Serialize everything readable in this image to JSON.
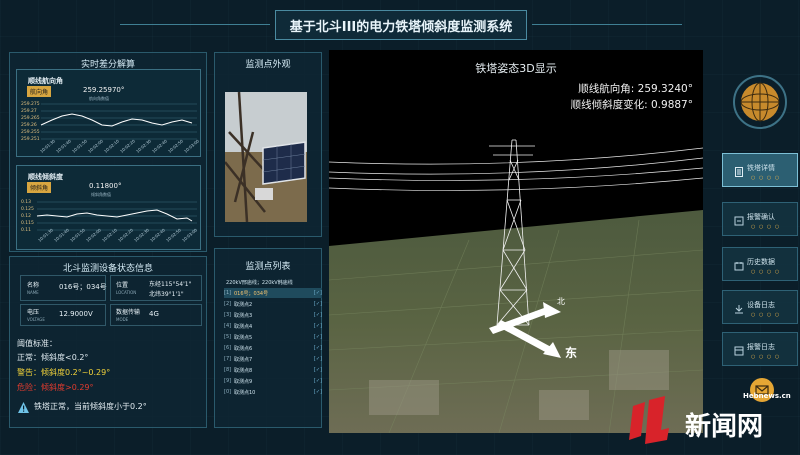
{
  "header": {
    "title": "基于北斗III的电力铁塔倾斜度监测系统"
  },
  "left_panel": {
    "title": "实时差分解算",
    "chart1": {
      "heading": "顺线航向角",
      "button": "航向角",
      "value": "259.25970°",
      "sub": "航向角数值",
      "yticks": [
        "259.275",
        "259.27",
        "259.265",
        "259.26",
        "259.255",
        "259.251"
      ],
      "xticks": [
        "10:01:30",
        "10:01:40",
        "10:01:50",
        "10:02:00",
        "10:02:10",
        "10:02:20",
        "10:02:30",
        "10:02:40",
        "10:02:50",
        "10:03:00"
      ]
    },
    "chart2": {
      "heading": "顺线倾斜度",
      "button": "倾斜角",
      "value": "0.11800°",
      "sub": "倾斜角数值",
      "yticks": [
        "0.13",
        "0.125",
        "0.12",
        "0.115",
        "0.11"
      ],
      "xticks": [
        "10:01:30",
        "10:01:40",
        "10:01:50",
        "10:02:00",
        "10:02:10",
        "10:02:20",
        "10:02:30",
        "10:02:40",
        "10:02:50",
        "10:03:00"
      ]
    }
  },
  "device_panel": {
    "title": "北斗监测设备状态信息",
    "name_label": "名称",
    "name_label_en": "NAME",
    "name_value": "016号；034号",
    "location_label": "位置",
    "location_label_en": "LOCATION",
    "location_value_1": "东经115°54'1\"",
    "location_value_2": "北纬39°1'1\"",
    "voltage_label": "电压",
    "voltage_label_en": "VOLTAGE",
    "voltage_value": "12.9000V",
    "mode_label": "数据传输",
    "mode_label_en": "MODE",
    "mode_value": "4G",
    "threshold_title": "阈值标准：",
    "normal": "正常：倾斜度<0.2°",
    "warning": "警告：倾斜度0.2°~0.29°",
    "danger": "危险：倾斜度>0.29°",
    "status": "铁塔正常，当前倾斜度小于0.2°",
    "colors": {
      "normal": "#dfeaf0",
      "warning": "#f2d23a",
      "danger": "#e23b2e",
      "status_icon": "#6fc3e8"
    }
  },
  "photo_panel": {
    "title": "监测点外观"
  },
  "list_panel": {
    "title": "监测点列表",
    "header": "220kV邢庙线；220kV韩庙线",
    "rows": [
      {
        "num": "[1]",
        "name": "016号；034号",
        "chk": "[✓]"
      },
      {
        "num": "[2]",
        "name": "取测点2",
        "chk": "[✓]"
      },
      {
        "num": "[3]",
        "name": "取测点3",
        "chk": "[✓]"
      },
      {
        "num": "[4]",
        "name": "取测点4",
        "chk": "[✓]"
      },
      {
        "num": "[5]",
        "name": "取测点5",
        "chk": "[✓]"
      },
      {
        "num": "[6]",
        "name": "取测点6",
        "chk": "[✓]"
      },
      {
        "num": "[7]",
        "name": "取测点7",
        "chk": "[✓]"
      },
      {
        "num": "[8]",
        "name": "取测点8",
        "chk": "[✓]"
      },
      {
        "num": "[9]",
        "name": "取测点9",
        "chk": "[✓]"
      },
      {
        "num": "[0]",
        "name": "取测点10",
        "chk": "[✓]"
      }
    ]
  },
  "scene": {
    "title": "铁塔姿态3D显示",
    "heading_line": "顺线航向角: 259.3240°",
    "tilt_line": "顺线倾斜度变化: 0.9887°",
    "compass_east": "东",
    "compass_north": "北"
  },
  "right_menu": {
    "items": [
      {
        "label": "铁塔详情",
        "icon": "document-icon"
      },
      {
        "label": "报警确认",
        "icon": "alarm-icon"
      },
      {
        "label": "历史数据",
        "icon": "history-icon"
      },
      {
        "label": "设备日志",
        "icon": "download-icon"
      },
      {
        "label": "报警日志",
        "icon": "log-icon"
      }
    ],
    "dots": "○ ○ ○ ○"
  },
  "watermark": {
    "site": "Hebnews.cn",
    "brand": "新闻网"
  }
}
